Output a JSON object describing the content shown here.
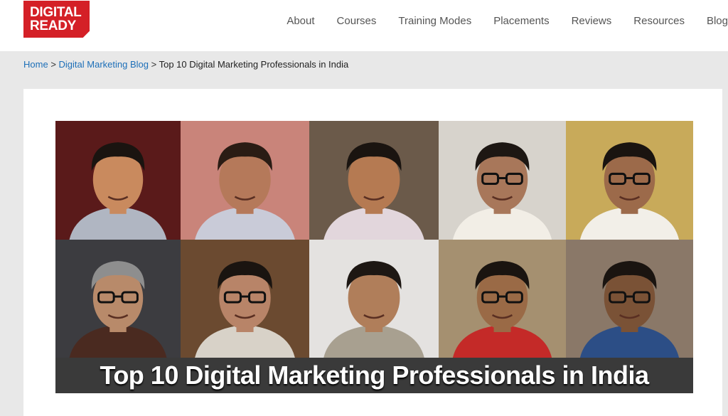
{
  "brand": {
    "line1": "DIGITAL",
    "line2": "READY",
    "color": "#d42027"
  },
  "nav": {
    "items": [
      "About",
      "Courses",
      "Training Modes",
      "Placements",
      "Reviews",
      "Resources",
      "Blog"
    ]
  },
  "breadcrumb": {
    "home": "Home",
    "sep1": ">",
    "blog": "Digital Marketing Blog",
    "sep2": ">",
    "current": "Top 10 Digital Marketing Professionals in India"
  },
  "hero": {
    "title": "Top 10 Digital Marketing Professionals in India",
    "portraits": [
      {
        "bg": "#5a1a1a",
        "skin": "#c98a5e",
        "hair": "#1a1410",
        "shirt": "#b0b6c2",
        "glasses": false
      },
      {
        "bg": "#c9847a",
        "skin": "#b5795a",
        "hair": "#2a1c14",
        "shirt": "#c9cbd8",
        "glasses": false
      },
      {
        "bg": "#6b5a4a",
        "skin": "#b57a52",
        "hair": "#1a1410",
        "shirt": "#e2d6dc",
        "glasses": false
      },
      {
        "bg": "#d7d3cc",
        "skin": "#a8775a",
        "hair": "#1d1713",
        "shirt": "#f2eee6",
        "glasses": true
      },
      {
        "bg": "#c8aa5a",
        "skin": "#9c6a4a",
        "hair": "#1a1410",
        "shirt": "#f2efe8",
        "glasses": true
      },
      {
        "bg": "#3c3c40",
        "skin": "#b88a6a",
        "hair": "#8e8e8e",
        "shirt": "#4a2a20",
        "glasses": true
      },
      {
        "bg": "#6b4a30",
        "skin": "#b88468",
        "hair": "#1a1410",
        "shirt": "#d8d2c8",
        "glasses": true
      },
      {
        "bg": "#e4e2e0",
        "skin": "#b07e5a",
        "hair": "#1d1713",
        "shirt": "#a8a090",
        "glasses": false
      },
      {
        "bg": "#a59070",
        "skin": "#9a6a46",
        "hair": "#1a1410",
        "shirt": "#c42a28",
        "glasses": true
      },
      {
        "bg": "#8a7868",
        "skin": "#7a5236",
        "hair": "#1a1410",
        "shirt": "#2c4e86",
        "glasses": true
      }
    ]
  }
}
